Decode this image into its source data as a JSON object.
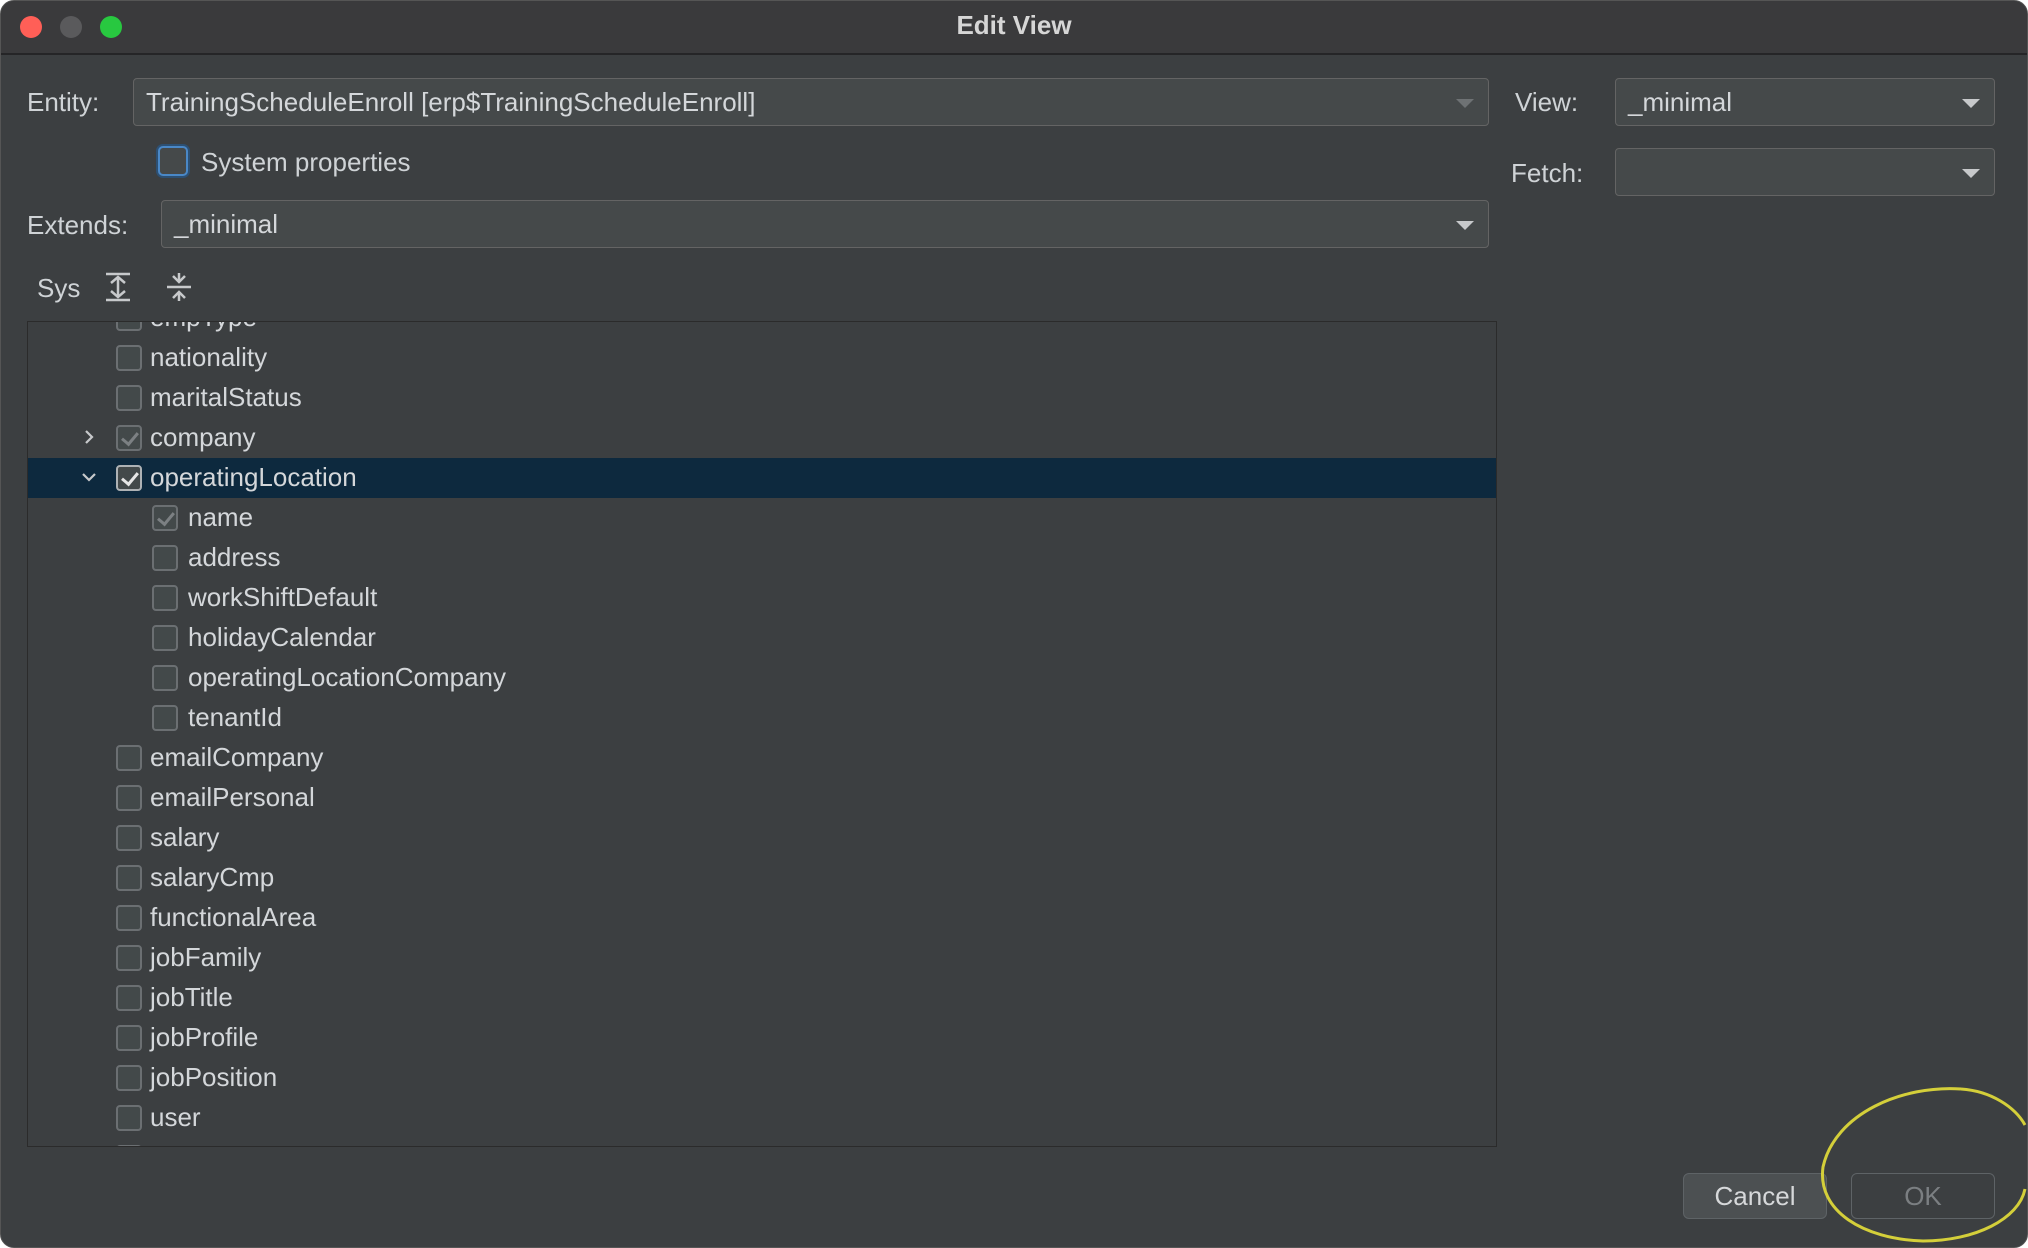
{
  "window": {
    "title": "Edit View"
  },
  "form": {
    "entity_label": "Entity:",
    "entity_value": "TrainingScheduleEnroll [erp$TrainingScheduleEnroll]",
    "view_label": "View:",
    "view_value": "_minimal",
    "fetch_label": "Fetch:",
    "fetch_value": "",
    "system_properties_label": "System properties",
    "system_properties_checked": false,
    "extends_label": "Extends:",
    "extends_value": "_minimal"
  },
  "toolbar": {
    "sys_label": "Sys",
    "expand_all_icon": "expand-all-icon",
    "collapse_all_icon": "collapse-all-icon"
  },
  "tree": {
    "partial_top_label": "empType",
    "items": [
      {
        "label": "nationality",
        "checked": false,
        "level": 1
      },
      {
        "label": "maritalStatus",
        "checked": false,
        "level": 1
      },
      {
        "label": "company",
        "checked": true,
        "dim": true,
        "level": 1,
        "expander": "collapsed"
      },
      {
        "label": "operatingLocation",
        "checked": true,
        "level": 1,
        "expander": "expanded",
        "selected": true
      },
      {
        "label": "name",
        "checked": true,
        "dim": true,
        "level": 2
      },
      {
        "label": "address",
        "checked": false,
        "level": 2
      },
      {
        "label": "workShiftDefault",
        "checked": false,
        "level": 2
      },
      {
        "label": "holidayCalendar",
        "checked": false,
        "level": 2
      },
      {
        "label": "operatingLocationCompany",
        "checked": false,
        "level": 2
      },
      {
        "label": "tenantId",
        "checked": false,
        "level": 2
      },
      {
        "label": "emailCompany",
        "checked": false,
        "level": 1
      },
      {
        "label": "emailPersonal",
        "checked": false,
        "level": 1
      },
      {
        "label": "salary",
        "checked": false,
        "level": 1
      },
      {
        "label": "salaryCmp",
        "checked": false,
        "level": 1
      },
      {
        "label": "functionalArea",
        "checked": false,
        "level": 1
      },
      {
        "label": "jobFamily",
        "checked": false,
        "level": 1
      },
      {
        "label": "jobTitle",
        "checked": false,
        "level": 1
      },
      {
        "label": "jobProfile",
        "checked": false,
        "level": 1
      },
      {
        "label": "jobPosition",
        "checked": false,
        "level": 1
      },
      {
        "label": "user",
        "checked": false,
        "level": 1
      }
    ]
  },
  "buttons": {
    "cancel_label": "Cancel",
    "ok_label": "OK",
    "ok_enabled": false
  },
  "colors": {
    "background": "#3c3f41",
    "selection": "#0d293e",
    "highlight_annotation": "#d4cf3a"
  }
}
